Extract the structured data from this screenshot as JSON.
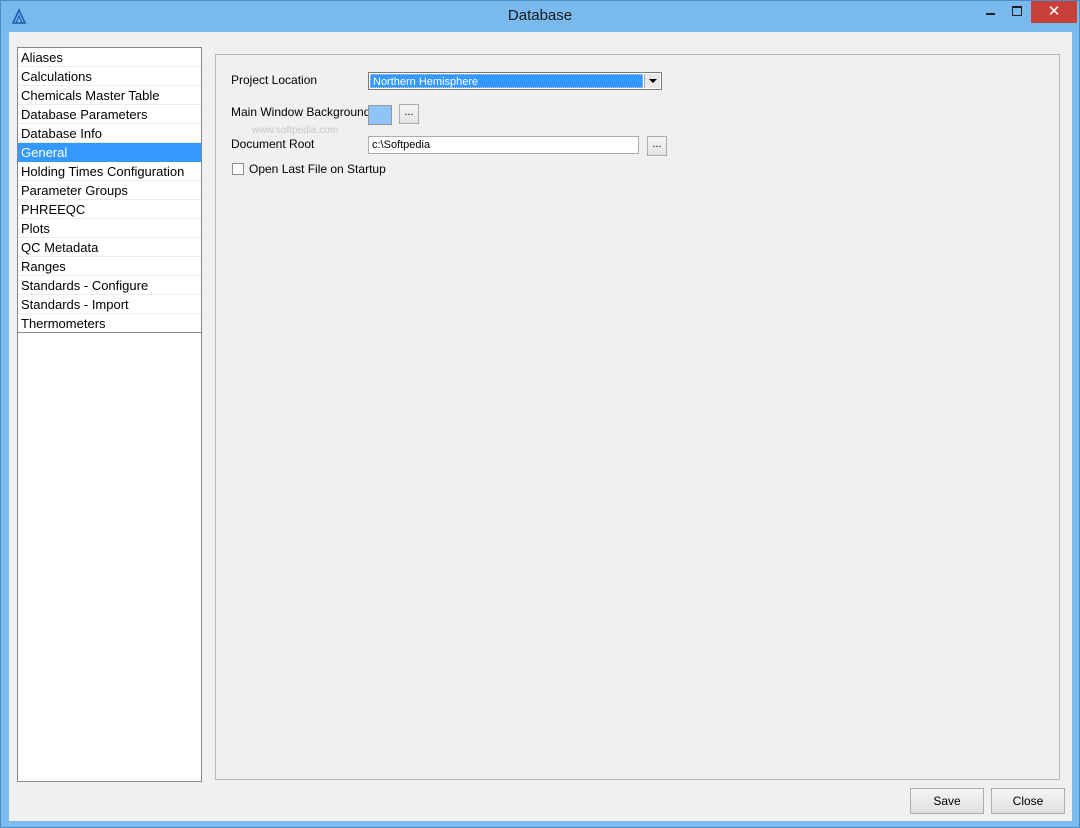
{
  "window": {
    "title": "Database"
  },
  "sidebar": {
    "items": [
      {
        "label": "Aliases"
      },
      {
        "label": "Calculations"
      },
      {
        "label": "Chemicals Master Table"
      },
      {
        "label": "Database Parameters"
      },
      {
        "label": "Database Info"
      },
      {
        "label": "General",
        "selected": true
      },
      {
        "label": "Holding Times Configuration"
      },
      {
        "label": "Parameter Groups"
      },
      {
        "label": "PHREEQC"
      },
      {
        "label": "Plots"
      },
      {
        "label": "QC Metadata"
      },
      {
        "label": "Ranges"
      },
      {
        "label": "Standards - Configure"
      },
      {
        "label": "Standards - Import"
      },
      {
        "label": "Thermometers"
      }
    ]
  },
  "general": {
    "project_location_label": "Project Location",
    "project_location_value": "Northern Hemisphere",
    "background_label": "Main Window Background",
    "background_color": "#8ec4f7",
    "browse_label": "...",
    "document_root_label": "Document Root",
    "document_root_value": "c:\\Softpedia",
    "open_last_label": "Open Last File on Startup",
    "open_last_checked": false,
    "watermark": "www.softpedia.com"
  },
  "footer": {
    "save_label": "Save",
    "close_label": "Close"
  },
  "colors": {
    "selection": "#3399ff",
    "titlebar": "#79b9ee",
    "close_button": "#c7403a"
  }
}
